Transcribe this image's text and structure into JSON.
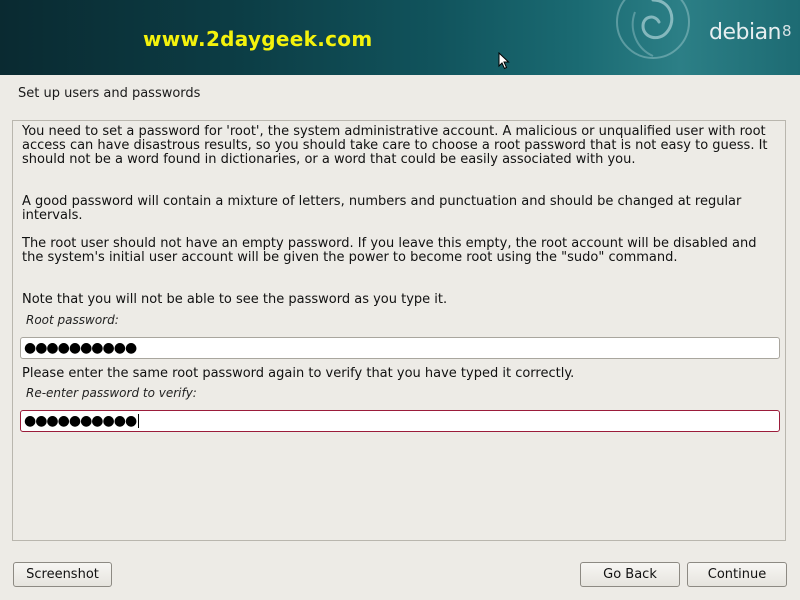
{
  "header": {
    "watermark": "www.2daygeek.com",
    "brand": "debian",
    "brand_version": "8",
    "logo_icon": "debian-swirl-icon",
    "colors": {
      "banner_dark": "#0a2a31",
      "banner_light": "#2c7f86",
      "watermark": "#f4f20c"
    }
  },
  "page": {
    "title": "Set up users and passwords"
  },
  "content": {
    "paragraphs": [
      "You need to set a password for 'root', the system administrative account. A malicious or unqualified user with root access can have disastrous results, so you should take care to choose a root password that is not easy to guess. It should not be a word found in dictionaries, or a word that could be easily associated with you.",
      "A good password will contain a mixture of letters, numbers and punctuation and should be changed at regular intervals.",
      "The root user should not have an empty password. If you leave this empty, the root account will be disabled and the system's initial user account will be given the power to become root using the \"sudo\" command.",
      "Note that you will not be able to see the password as you type it.",
      "Please enter the same root password again to verify that you have typed it correctly."
    ],
    "root_password": {
      "label": "Root password:",
      "value": "●●●●●●●●●●"
    },
    "verify_password": {
      "label": "Re-enter password to verify:",
      "value": "●●●●●●●●●●",
      "focus_color": "#9b1c3a"
    }
  },
  "buttons": {
    "screenshot": "Screenshot",
    "go_back": "Go Back",
    "continue": "Continue"
  }
}
